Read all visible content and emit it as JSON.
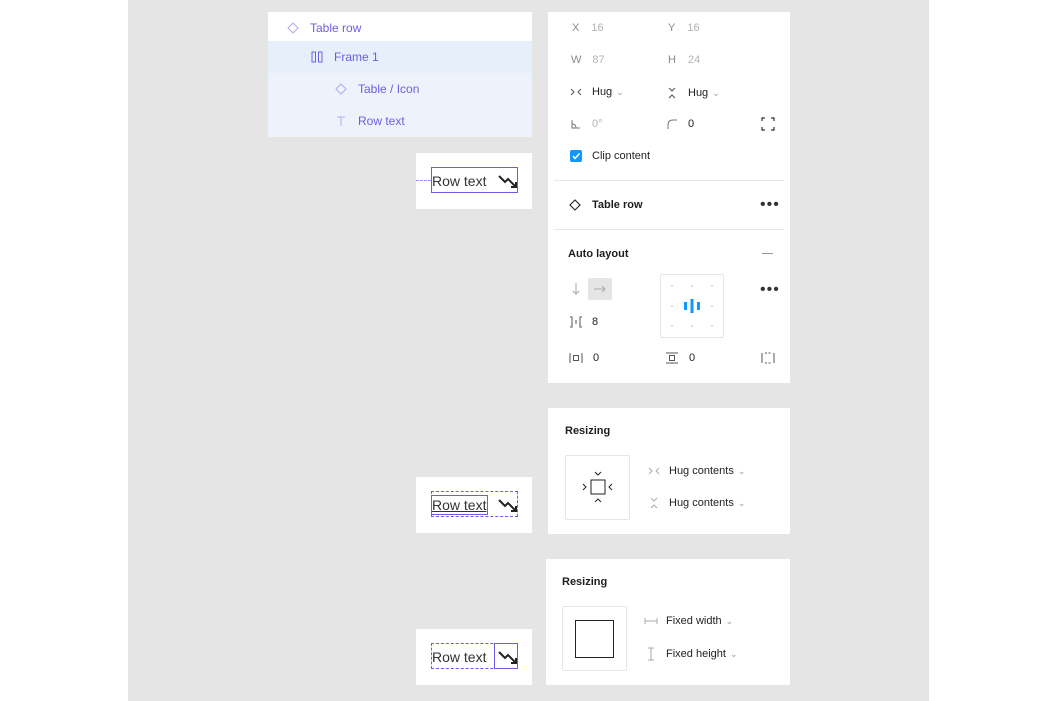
{
  "layers": [
    {
      "label": "Table row",
      "icon": "component-instance-icon"
    },
    {
      "label": "Frame 1",
      "icon": "auto-layout-horizontal-icon"
    },
    {
      "label": "Table / Icon",
      "icon": "component-instance-icon"
    },
    {
      "label": "Row text",
      "icon": "text-layer-icon"
    }
  ],
  "design": {
    "x_label": "X",
    "x_value": "16",
    "y_label": "Y",
    "y_value": "16",
    "w_label": "W",
    "w_value": "87",
    "h_label": "H",
    "h_value": "24",
    "width_mode": "Hug",
    "height_mode": "Hug",
    "rotation": "0°",
    "corner_radius": "0",
    "clip_content_label": "Clip content",
    "clip_content_checked": true,
    "component_name": "Table row",
    "auto_layout_title": "Auto layout",
    "gap": "8",
    "padding_horizontal": "0",
    "padding_vertical": "0"
  },
  "resizing_panels": [
    {
      "title": "Resizing",
      "horizontal": "Hug contents",
      "vertical": "Hug contents"
    },
    {
      "title": "Resizing",
      "horizontal": "Fixed width",
      "vertical": "Fixed height"
    }
  ],
  "previews": [
    {
      "text": "Row text"
    },
    {
      "text": "Row text"
    },
    {
      "text": "Row text"
    }
  ],
  "colors": {
    "accent": "#0d99ff",
    "selection": "#6f5ce6",
    "canvas": "#e5e5e5",
    "layer_selected": "#e7effb"
  }
}
